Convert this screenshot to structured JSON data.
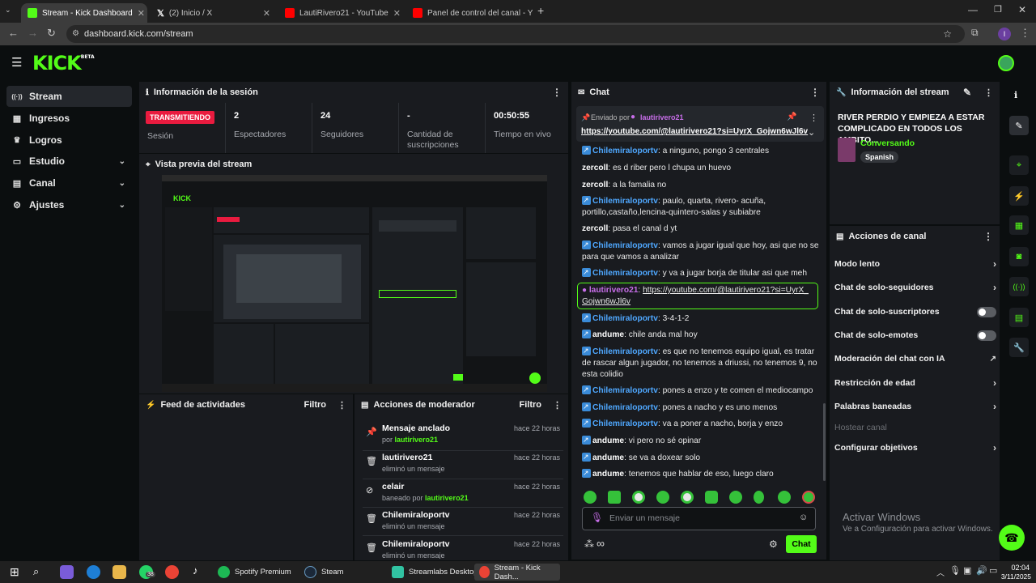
{
  "browser": {
    "tabs": [
      {
        "label": "Stream - Kick Dashboard",
        "favicon_color": "#53fc18"
      },
      {
        "label": "(2) Inicio / X",
        "favicon_color": "#000000"
      },
      {
        "label": "LautiRivero21 - YouTube",
        "favicon_color": "#ff0000"
      },
      {
        "label": "Panel de control del canal - You",
        "favicon_color": "#ff0000"
      }
    ],
    "url": "dashboard.kick.com/stream",
    "profile_initial": "I"
  },
  "header": {
    "logo": "KICK",
    "logo_sup": "BETA"
  },
  "sidebar": {
    "items": [
      {
        "label": "Stream",
        "icon": "broadcast-icon",
        "glyph": "((·))"
      },
      {
        "label": "Ingresos",
        "icon": "money-icon",
        "glyph": "▦"
      },
      {
        "label": "Logros",
        "icon": "trophy-icon",
        "glyph": "🏆"
      },
      {
        "label": "Estudio",
        "icon": "studio-icon",
        "glyph": "▭"
      },
      {
        "label": "Canal",
        "icon": "channel-icon",
        "glyph": "▤"
      },
      {
        "label": "Ajustes",
        "icon": "gear-icon",
        "glyph": "⚙"
      }
    ]
  },
  "session": {
    "title": "Información de la sesión",
    "live_badge": "TRANSMITIENDO",
    "session_label": "Sesión",
    "stats": [
      {
        "value": "2",
        "label": "Espectadores"
      },
      {
        "value": "24",
        "label": "Seguidores"
      },
      {
        "value": "-",
        "label": "Cantidad de suscripciones"
      },
      {
        "value": "00:50:55",
        "label": "Tiempo en vivo"
      }
    ]
  },
  "preview": {
    "title": "Vista previa del stream"
  },
  "activity": {
    "title": "Feed de actividades",
    "filter": "Filtro"
  },
  "modactions": {
    "title": "Acciones de moderador",
    "filter": "Filtro",
    "items": [
      {
        "title": "Mensaje anclado",
        "sub_prefix": "por ",
        "sub_user": "lautirivero21",
        "time": "hace 22 horas",
        "icon": "pin-icon"
      },
      {
        "title": "lautirivero21",
        "sub_prefix": "eliminó un mensaje",
        "sub_user": "",
        "time": "hace 22 horas",
        "icon": "trash-icon"
      },
      {
        "title": "celair",
        "sub_prefix": "baneado por ",
        "sub_user": "lautirivero21",
        "time": "hace 22 horas",
        "icon": "ban-icon"
      },
      {
        "title": "Chilemiraloportv",
        "sub_prefix": "eliminó un mensaje",
        "sub_user": "",
        "time": "hace 22 horas",
        "icon": "trash-icon"
      },
      {
        "title": "Chilemiraloportv",
        "sub_prefix": "eliminó un mensaje",
        "sub_user": "",
        "time": "hace 22 horas",
        "icon": "trash-icon"
      }
    ]
  },
  "chat": {
    "title": "Chat",
    "pinned": {
      "sent_by": "Enviado por",
      "user": "lautirivero21",
      "link": "https://youtube.com/@lautirivero21?si=UyrX_Gojwn6wJl6v"
    },
    "messages": [
      {
        "user": "Chilemiraloportv",
        "text": "a ninguno, pongo 3 centrales",
        "badge": true
      },
      {
        "user": "zercoll",
        "text": "es d riber pero l chupa un huevo",
        "badge": false
      },
      {
        "user": "zercoll",
        "text": "a la famalia no",
        "badge": false
      },
      {
        "user": "Chilemiraloportv",
        "text": "paulo, quarta, rivero- acuña, portillo,castaño,lencina-quintero-salas y subiabre",
        "badge": true
      },
      {
        "user": "zercoll",
        "text": "pasa el canal d yt",
        "badge": false
      },
      {
        "user": "Chilemiraloportv",
        "text": "vamos a jugar igual que hoy, asi que no se para que vamos a analizar",
        "badge": true
      },
      {
        "user": "Chilemiraloportv",
        "text": "y va a jugar borja de titular asi que meh",
        "badge": true
      },
      {
        "user": "lautirivero21",
        "text": "https://youtube.com/@lautirivero21?si=UyrX_Gojwn6wJl6v",
        "badge": false
      },
      {
        "user": "Chilemiraloportv",
        "text": "3-4-1-2",
        "badge": true
      },
      {
        "user": "andume",
        "text": "chile anda mal hoy",
        "badge": true
      },
      {
        "user": "Chilemiraloportv",
        "text": "es que no tenemos equipo igual, es tratar de rascar algun jugador, no tenemos a driussi, no tenemos 9, no esta colidio",
        "badge": true
      },
      {
        "user": "Chilemiraloportv",
        "text": "pones a enzo y te comen el mediocampo",
        "badge": true
      },
      {
        "user": "Chilemiraloportv",
        "text": "pones a nacho y es uno menos",
        "badge": true
      },
      {
        "user": "Chilemiraloportv",
        "text": "va a poner a nacho, borja y enzo",
        "badge": true
      },
      {
        "user": "andume",
        "text": "vi pero no sé opinar",
        "badge": true
      },
      {
        "user": "andume",
        "text": "se va a doxear solo",
        "badge": true
      },
      {
        "user": "andume",
        "text": "tenemos que hablar de eso, luego claro",
        "badge": true
      }
    ],
    "input_placeholder": "Enviar un mensaje",
    "send_label": "Chat"
  },
  "streaminfo": {
    "title": "Información del stream",
    "stream_title": "RIVER PERDIO Y EMPIEZA A ESTAR COMPLICADO EN TODOS LOS AMBITO...",
    "category": "Conversando",
    "language": "Spanish"
  },
  "channel_actions": {
    "title": "Acciones de canal",
    "rows": [
      {
        "label": "Modo lento",
        "kind": "chevron"
      },
      {
        "label": "Chat de solo-seguidores",
        "kind": "chevron"
      },
      {
        "label": "Chat de solo-suscriptores",
        "kind": "toggle"
      },
      {
        "label": "Chat de solo-emotes",
        "kind": "toggle"
      },
      {
        "label": "Moderación del chat con IA",
        "kind": "external"
      },
      {
        "label": "Restricción de edad",
        "kind": "chevron"
      },
      {
        "label": "Palabras baneadas",
        "kind": "chevron"
      },
      {
        "label": "Hostear canal",
        "kind": "disabled"
      },
      {
        "label": "Configurar objetivos",
        "kind": "chevron"
      }
    ]
  },
  "windows_watermark": {
    "title": "Activar Windows",
    "sub": "Ve a Configuración para activar Windows."
  },
  "taskbar": {
    "apps": [
      {
        "label": "Spotify Premium"
      },
      {
        "label": "Steam"
      },
      {
        "label": "Streamlabs Desktop"
      },
      {
        "label": "Stream - Kick Dash..."
      }
    ],
    "whatsapp_badge": "38",
    "time": "02:04",
    "date": "3/11/2025"
  },
  "colors": {
    "kick_green": "#53fc18",
    "live_red": "#e91b3f",
    "panel_bg": "#191b1f",
    "page_bg": "#0b0e0f"
  }
}
